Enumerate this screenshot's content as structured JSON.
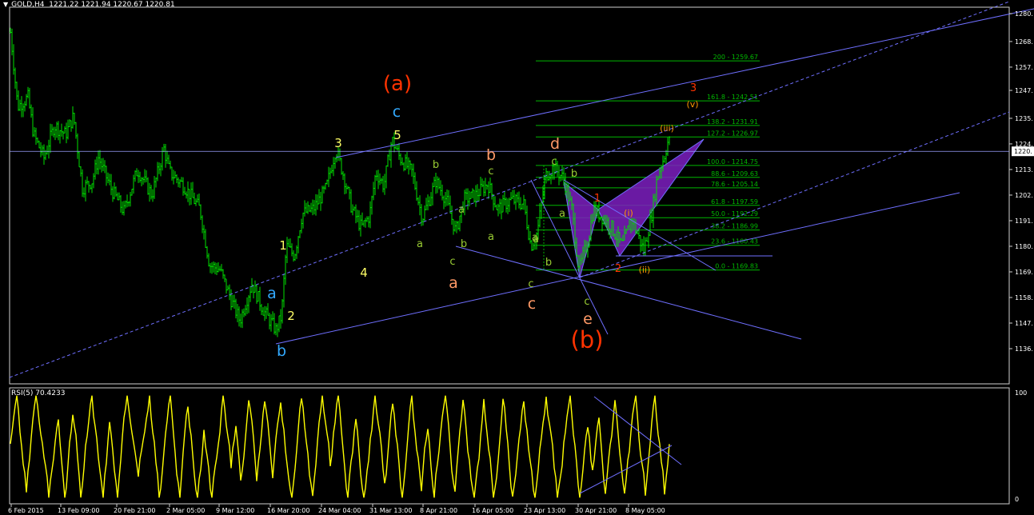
{
  "header": {
    "menu_arrow": "▼",
    "symbol": "GOLD,H4",
    "ohlc": "1221.22 1221.94 1220.67 1220.81"
  },
  "rsi_header": "RSI(5) 70.4233",
  "colors": {
    "background": "#000000",
    "candles": "#00e000",
    "rsi_line": "#ffff00",
    "trendline": "#6f6fff",
    "fib": "#00b800",
    "pattern_fill": "#7d1fbf",
    "label_yellow": "#ffff66",
    "label_green": "#99cc33",
    "label_salmon": "#ff9966",
    "label_blue": "#33aaff",
    "label_red": "#ff3300",
    "label_orange": "#ff9900"
  },
  "chart_data": {
    "type": "candlestick",
    "symbol": "GOLD",
    "timeframe": "H4",
    "price_axis": [
      "1280.",
      "1268.",
      "1257.",
      "1247.",
      "1235.",
      "1224.",
      "1213.",
      "1202.",
      "1191.",
      "1180.",
      "1169.",
      "1158.",
      "1147.",
      "1136."
    ],
    "current_price_label": "1220.",
    "time_axis": [
      "6 Feb 2015",
      "13 Feb 09:00",
      "20 Feb 21:00",
      "2 Mar 05:00",
      "9 Mar 12:00",
      "16 Mar 20:00",
      "24 Mar 04:00",
      "31 Mar 13:00",
      "8 Apr 21:00",
      "16 Apr 05:00",
      "23 Apr 13:00",
      "30 Apr 21:00",
      "8 May 05:00"
    ],
    "rsi_axis": [
      "100",
      "0"
    ],
    "fib_levels": [
      {
        "label": "200 - 1259.67",
        "price": 1259.67
      },
      {
        "label": "161.8 - 1242.51",
        "price": 1242.51
      },
      {
        "label": "138.2 - 1231.91",
        "price": 1231.91
      },
      {
        "label": "127.2 - 1226.97",
        "price": 1226.97
      },
      {
        "label": "100.0 - 1214.75",
        "price": 1214.75
      },
      {
        "label": "88.6 - 1209.63",
        "price": 1209.63
      },
      {
        "label": "78.6 - 1205.14",
        "price": 1205.14
      },
      {
        "label": "61.8 - 1197.59",
        "price": 1197.59
      },
      {
        "label": "50.0 - 1192.29",
        "price": 1192.29
      },
      {
        "label": "38.2 - 1186.99",
        "price": 1186.99
      },
      {
        "label": "23.6 - 1180.43",
        "price": 1180.43
      },
      {
        "label": "0.0 - 1169.83",
        "price": 1169.83
      }
    ],
    "wave_labels": [
      {
        "text": "(a)",
        "color": "label_red"
      },
      {
        "text": "c",
        "color": "label_blue"
      },
      {
        "text": "3",
        "color": "label_yellow"
      },
      {
        "text": "5",
        "color": "label_yellow"
      },
      {
        "text": "1",
        "color": "label_yellow"
      },
      {
        "text": "2",
        "color": "label_yellow"
      },
      {
        "text": "4",
        "color": "label_yellow"
      },
      {
        "text": "a",
        "color": "label_blue"
      },
      {
        "text": "b",
        "color": "label_blue"
      },
      {
        "text": "b",
        "color": "label_green"
      },
      {
        "text": "a",
        "color": "label_green"
      },
      {
        "text": "a",
        "color": "label_green"
      },
      {
        "text": "b",
        "color": "label_green"
      },
      {
        "text": "c",
        "color": "label_green"
      },
      {
        "text": "a",
        "color": "label_green"
      },
      {
        "text": "b",
        "color": "label_salmon"
      },
      {
        "text": "c",
        "color": "label_green"
      },
      {
        "text": "a",
        "color": "label_salmon"
      },
      {
        "text": "a",
        "color": "label_green"
      },
      {
        "text": "d",
        "color": "label_salmon"
      },
      {
        "text": "c",
        "color": "label_green"
      },
      {
        "text": "b",
        "color": "label_green"
      },
      {
        "text": "a",
        "color": "label_green"
      },
      {
        "text": "a",
        "color": "label_green"
      },
      {
        "text": "b",
        "color": "label_green"
      },
      {
        "text": "c",
        "color": "label_green"
      },
      {
        "text": "c",
        "color": "label_salmon"
      },
      {
        "text": "c",
        "color": "label_green"
      },
      {
        "text": "e",
        "color": "label_salmon"
      },
      {
        "text": "(b)",
        "color": "label_red"
      },
      {
        "text": "1",
        "color": "label_red"
      },
      {
        "text": "2",
        "color": "label_red"
      },
      {
        "text": "3",
        "color": "label_red"
      },
      {
        "text": "(i)",
        "color": "label_orange"
      },
      {
        "text": "(ii)",
        "color": "label_orange"
      },
      {
        "text": "(iii)",
        "color": "label_orange"
      },
      {
        "text": "(v)",
        "color": "label_orange"
      }
    ]
  }
}
